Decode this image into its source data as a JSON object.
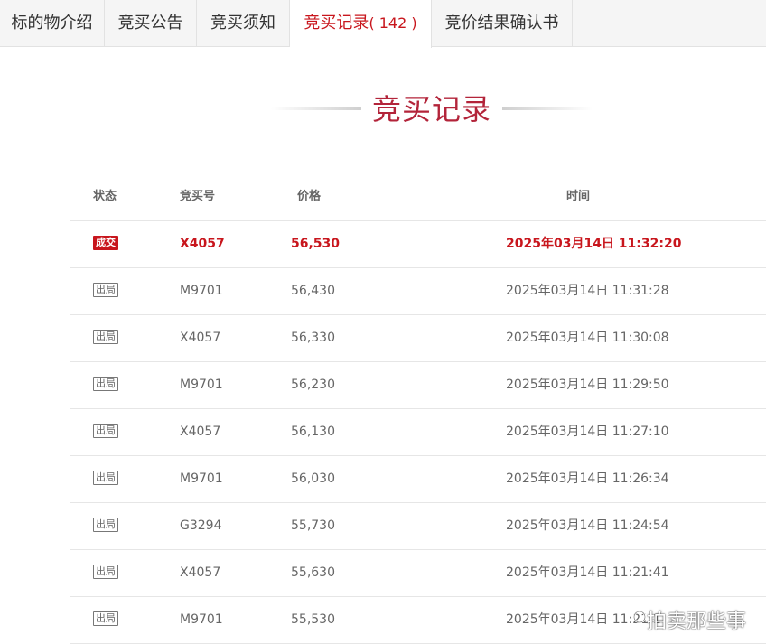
{
  "tabs": [
    {
      "label": "标的物介绍"
    },
    {
      "label": "竞买公告"
    },
    {
      "label": "竞买须知"
    },
    {
      "label": "竞买记录",
      "count": "( 142 )"
    },
    {
      "label": "竞价结果确认书"
    }
  ],
  "section_title": "竞买记录",
  "table": {
    "headers": {
      "status": "状态",
      "bidder": "竞买号",
      "price": "价格",
      "time": "时间"
    },
    "rows": [
      {
        "status": "成交",
        "bidder": "X4057",
        "price": "56,530",
        "time": "2025年03月14日 11:32:20"
      },
      {
        "status": "出局",
        "bidder": "M9701",
        "price": "56,430",
        "time": "2025年03月14日 11:31:28"
      },
      {
        "status": "出局",
        "bidder": "X4057",
        "price": "56,330",
        "time": "2025年03月14日 11:30:08"
      },
      {
        "status": "出局",
        "bidder": "M9701",
        "price": "56,230",
        "time": "2025年03月14日 11:29:50"
      },
      {
        "status": "出局",
        "bidder": "X4057",
        "price": "56,130",
        "time": "2025年03月14日 11:27:10"
      },
      {
        "status": "出局",
        "bidder": "M9701",
        "price": "56,030",
        "time": "2025年03月14日 11:26:34"
      },
      {
        "status": "出局",
        "bidder": "G3294",
        "price": "55,730",
        "time": "2025年03月14日 11:24:54"
      },
      {
        "status": "出局",
        "bidder": "X4057",
        "price": "55,630",
        "time": "2025年03月14日 11:21:41"
      },
      {
        "status": "出局",
        "bidder": "M9701",
        "price": "55,530",
        "time": "2025年03月14日 11:21:1"
      }
    ]
  },
  "watermark": "拍卖那些事",
  "colors": {
    "accent": "#c8161d",
    "heading": "#b3243a"
  }
}
